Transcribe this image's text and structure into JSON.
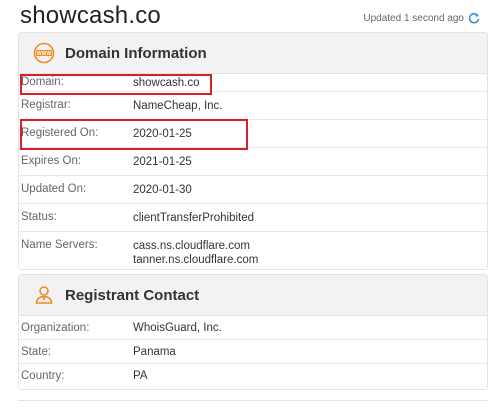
{
  "header": {
    "title": "showcash.co",
    "updated": "Updated 1 second ago"
  },
  "domain_info": {
    "title": "Domain Information",
    "rows": [
      {
        "label": "Domain:",
        "value": [
          "showcash.co"
        ]
      },
      {
        "label": "Registrar:",
        "value": [
          "NameCheap, Inc."
        ]
      },
      {
        "label": "Registered On:",
        "value": [
          "2020-01-25"
        ]
      },
      {
        "label": "Expires On:",
        "value": [
          "2021-01-25"
        ]
      },
      {
        "label": "Updated On:",
        "value": [
          "2020-01-30"
        ]
      },
      {
        "label": "Status:",
        "value": [
          "clientTransferProhibited"
        ]
      },
      {
        "label": "Name Servers:",
        "value": [
          "cass.ns.cloudflare.com",
          "tanner.ns.cloudflare.com"
        ]
      }
    ]
  },
  "registrant": {
    "title": "Registrant Contact",
    "rows": [
      {
        "label": "Organization:",
        "value": "WhoisGuard, Inc."
      },
      {
        "label": "State:",
        "value": "Panama"
      },
      {
        "label": "Country:",
        "value": "PA"
      }
    ]
  },
  "colors": {
    "highlight": "#d81f26",
    "icon_orange": "#f08a24",
    "refresh_blue": "#3b8fd6"
  },
  "icons": {
    "domain": "www-globe-icon",
    "registrant": "person-icon",
    "refresh": "refresh-icon"
  }
}
